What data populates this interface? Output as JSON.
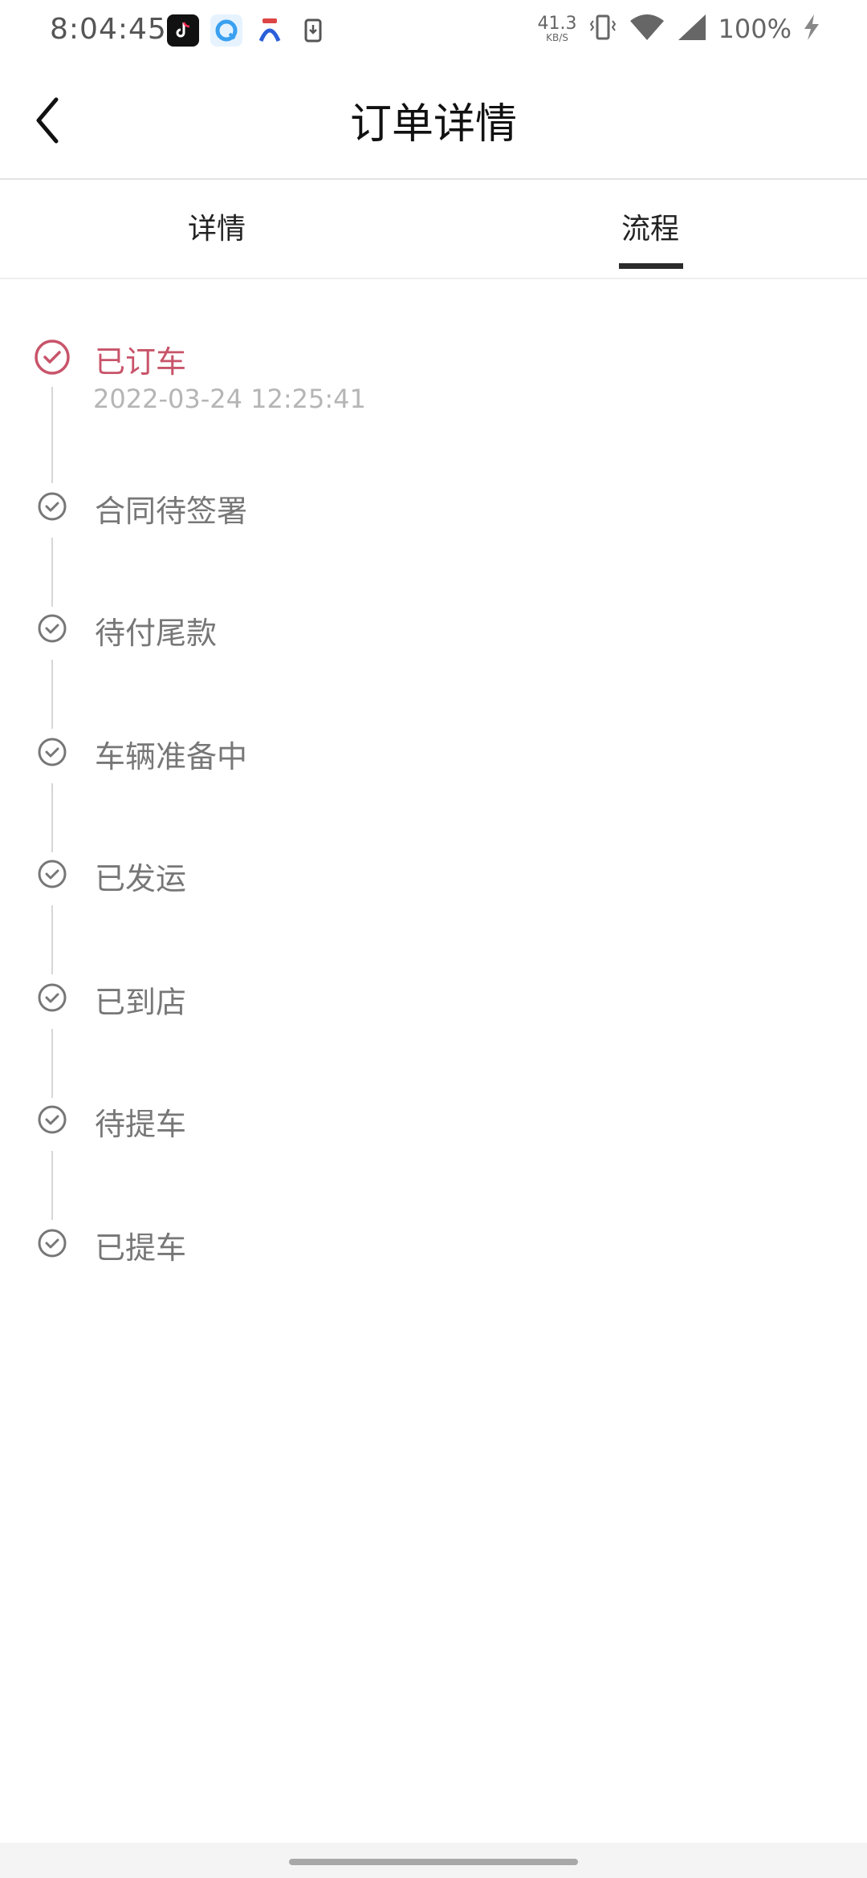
{
  "status_bar": {
    "time": "8:04:45",
    "net_speed_value": "41.3",
    "net_speed_unit": "KB/S",
    "battery": "100%",
    "icons": [
      "tiktok-icon",
      "browser-icon",
      "car-app-icon",
      "download-icon",
      "vibrate-icon",
      "wifi-icon",
      "signal-icon",
      "charging-icon"
    ]
  },
  "header": {
    "title": "订单详情",
    "back_icon": "chevron-left-icon"
  },
  "tabs": [
    {
      "label": "详情",
      "selected": false
    },
    {
      "label": "流程",
      "selected": true
    }
  ],
  "timeline": {
    "steps": [
      {
        "label": "已订车",
        "time": "2022-03-24 12:25:41",
        "active": true
      },
      {
        "label": "合同待签署",
        "active": false
      },
      {
        "label": "待付尾款",
        "active": false
      },
      {
        "label": "车辆准备中",
        "active": false
      },
      {
        "label": "已发运",
        "active": false
      },
      {
        "label": "已到店",
        "active": false
      },
      {
        "label": "待提车",
        "active": false
      },
      {
        "label": "已提车",
        "active": false
      }
    ]
  },
  "colors": {
    "active": "#c8546a",
    "inactive": "#777777",
    "tab_indicator": "#2b2b2b"
  }
}
